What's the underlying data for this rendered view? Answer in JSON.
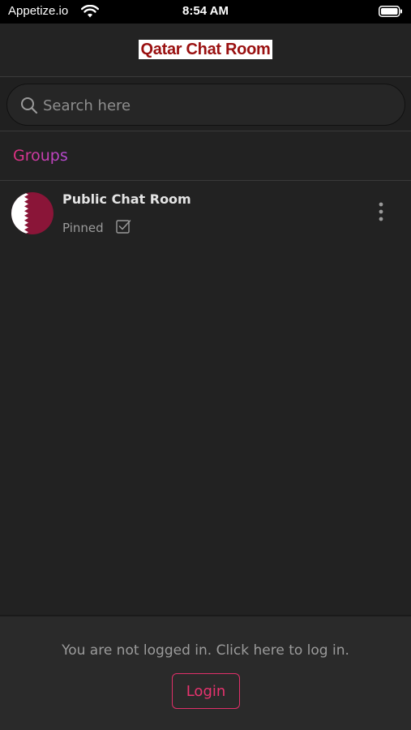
{
  "status_bar": {
    "carrier": "Appetize.io",
    "time": "8:54 AM",
    "icons": [
      "wifi-icon",
      "battery-icon"
    ]
  },
  "header": {
    "title": "Qatar Chat Room"
  },
  "search": {
    "placeholder": "Search here",
    "value": ""
  },
  "groups": {
    "title": "Groups",
    "items": [
      {
        "title": "Public Chat Room",
        "subtitle": "Pinned",
        "avatar": "qatar-flag",
        "pinned": true
      }
    ]
  },
  "footer": {
    "message": "You are not logged in. Click here to log in.",
    "login_label": "Login"
  },
  "colors": {
    "background": "#222222",
    "accent_pink": "#e0307f",
    "accent_purple": "#b44bd6",
    "qatar_maroon": "#8a1538",
    "title_red": "#9a1010"
  }
}
